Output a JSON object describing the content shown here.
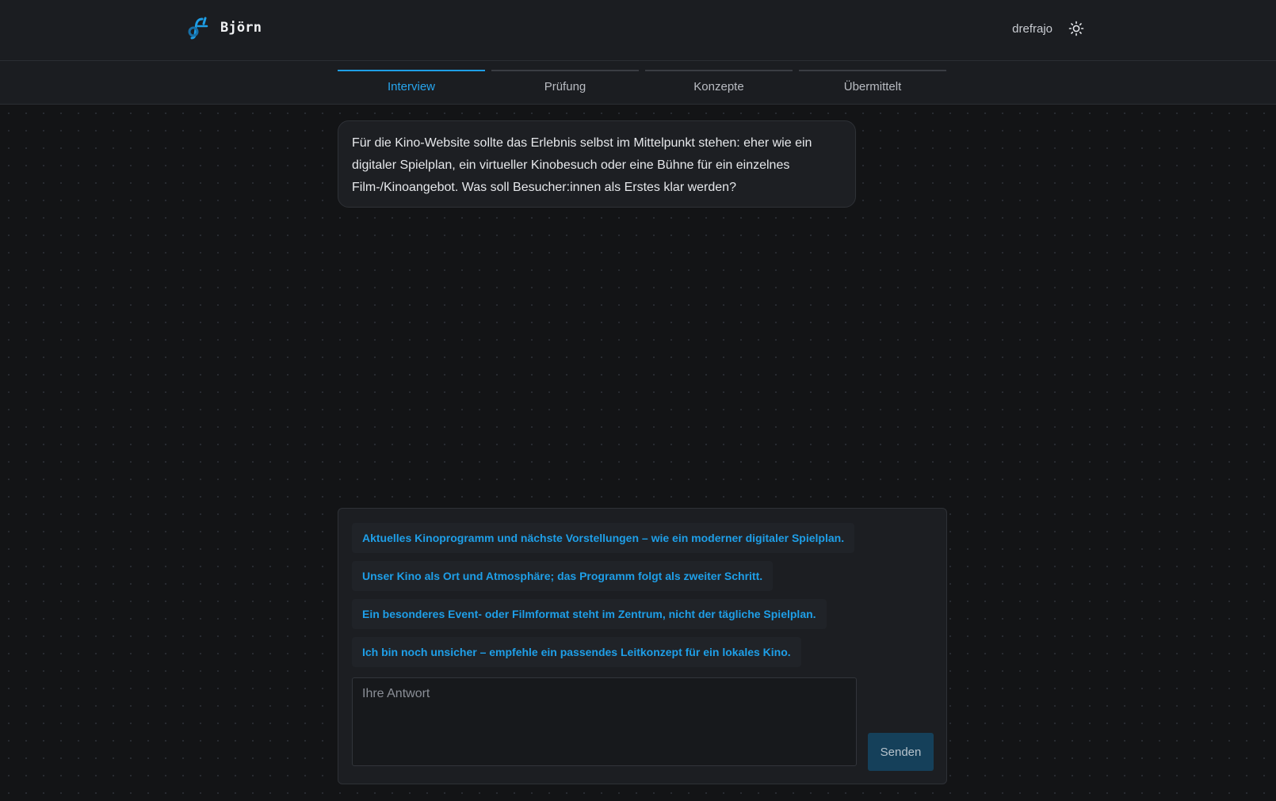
{
  "app": {
    "brand_name": "Björn",
    "logo_icon": "df-logo-icon",
    "accent_color": "#1e9ee6"
  },
  "header": {
    "username": "drefrajo",
    "theme_toggle_icon": "sun-icon"
  },
  "tabs": [
    {
      "label": "Interview",
      "active": true
    },
    {
      "label": "Prüfung",
      "active": false
    },
    {
      "label": "Konzepte",
      "active": false
    },
    {
      "label": "Übermittelt",
      "active": false
    }
  ],
  "question": {
    "text": "Für die Kino-Website sollte das Erlebnis selbst im Mittelpunkt stehen: eher wie ein digitaler Spielplan, ein virtueller Kinobesuch oder eine Bühne für ein einzelnes Film-/Kinoangebot. Was soll Besucher:innen als Erstes klar werden?"
  },
  "answer": {
    "options": [
      "Aktuelles Kinoprogramm und nächste Vorstellungen – wie ein moderner digitaler Spielplan.",
      "Unser Kino als Ort und Atmosphäre; das Programm folgt als zweiter Schritt.",
      "Ein besonderes Event- oder Filmformat steht im Zentrum, nicht der tägliche Spielplan.",
      "Ich bin noch unsicher – empfehle ein passendes Leitkonzept für ein lokales Kino."
    ],
    "input_value": "",
    "input_placeholder": "Ihre Antwort",
    "send_label": "Senden"
  }
}
